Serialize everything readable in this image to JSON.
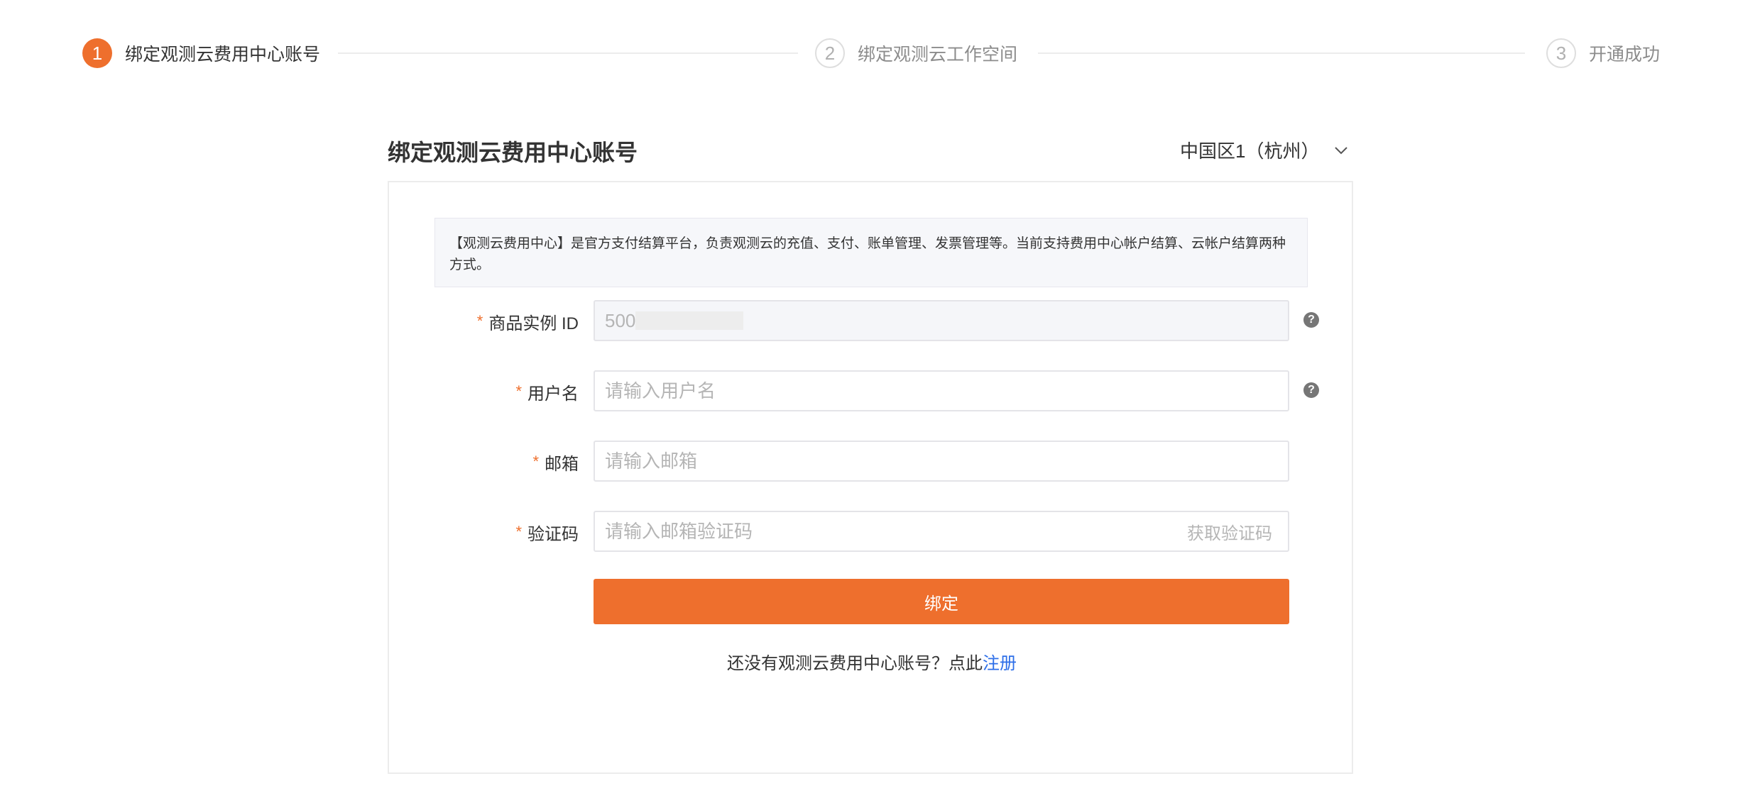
{
  "steps": [
    {
      "num": "1",
      "label": "绑定观测云费用中心账号",
      "state": "active"
    },
    {
      "num": "2",
      "label": "绑定观测云工作空间",
      "state": "todo"
    },
    {
      "num": "3",
      "label": "开通成功",
      "state": "todo"
    }
  ],
  "header": {
    "title": "绑定观测云费用中心账号",
    "region": "中国区1（杭州）"
  },
  "notice": "【观测云费用中心】是官方支付结算平台，负责观测云的充值、支付、账单管理、发票管理等。当前支持费用中心帐户结算、云帐户结算两种方式。",
  "form": {
    "required_mark": "*",
    "instance_id": {
      "label": "商品实例 ID",
      "value": "500"
    },
    "username": {
      "label": "用户名",
      "placeholder": "请输入用户名"
    },
    "email": {
      "label": "邮箱",
      "placeholder": "请输入邮箱"
    },
    "code": {
      "label": "验证码",
      "placeholder": "请输入邮箱验证码",
      "action": "获取验证码"
    },
    "help_glyph": "?",
    "submit_label": "绑定"
  },
  "signup": {
    "prompt": "还没有观测云费用中心账号？点此",
    "link": "注册"
  },
  "colors": {
    "accent": "#ee6f2d",
    "link": "#2c6ee8"
  }
}
